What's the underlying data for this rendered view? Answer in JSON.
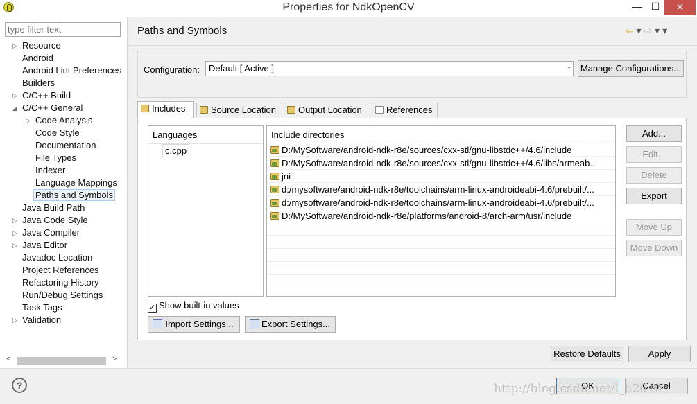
{
  "window": {
    "title": "Properties for NdkOpenCV",
    "controls": {
      "minimize": "—",
      "maximize": "☐",
      "close": "✕"
    }
  },
  "left": {
    "filter_placeholder": "type filter text",
    "tree": [
      {
        "label": "Resource",
        "expandable": true,
        "expanded": false,
        "level": 0
      },
      {
        "label": "Android",
        "expandable": false,
        "level": 0
      },
      {
        "label": "Android Lint Preferences",
        "expandable": false,
        "level": 0
      },
      {
        "label": "Builders",
        "expandable": false,
        "level": 0
      },
      {
        "label": "C/C++ Build",
        "expandable": true,
        "expanded": false,
        "level": 0
      },
      {
        "label": "C/C++ General",
        "expandable": true,
        "expanded": true,
        "level": 0
      },
      {
        "label": "Code Analysis",
        "expandable": true,
        "expanded": false,
        "level": 1
      },
      {
        "label": "Code Style",
        "expandable": false,
        "level": 1
      },
      {
        "label": "Documentation",
        "expandable": false,
        "level": 1
      },
      {
        "label": "File Types",
        "expandable": false,
        "level": 1
      },
      {
        "label": "Indexer",
        "expandable": false,
        "level": 1
      },
      {
        "label": "Language Mappings",
        "expandable": false,
        "level": 1
      },
      {
        "label": "Paths and Symbols",
        "expandable": false,
        "level": 1,
        "selected": true
      },
      {
        "label": "Java Build Path",
        "expandable": false,
        "level": 0
      },
      {
        "label": "Java Code Style",
        "expandable": true,
        "expanded": false,
        "level": 0
      },
      {
        "label": "Java Compiler",
        "expandable": true,
        "expanded": false,
        "level": 0
      },
      {
        "label": "Java Editor",
        "expandable": true,
        "expanded": false,
        "level": 0
      },
      {
        "label": "Javadoc Location",
        "expandable": false,
        "level": 0
      },
      {
        "label": "Project References",
        "expandable": false,
        "level": 0
      },
      {
        "label": "Refactoring History",
        "expandable": false,
        "level": 0
      },
      {
        "label": "Run/Debug Settings",
        "expandable": false,
        "level": 0
      },
      {
        "label": "Task Tags",
        "expandable": false,
        "level": 0
      },
      {
        "label": "Validation",
        "expandable": true,
        "expanded": false,
        "level": 0
      }
    ]
  },
  "main": {
    "title": "Paths and Symbols",
    "nav": {
      "back": "⇦",
      "forward": "⇨",
      "dropdown": "▾",
      "menu": "▾"
    },
    "configuration": {
      "label": "Configuration:",
      "value": "Default  [ Active ]",
      "manage_label": "Manage Configurations..."
    },
    "tabs": [
      {
        "label": "Includes",
        "active": true
      },
      {
        "label": "Source Location",
        "active": false
      },
      {
        "label": "Output Location",
        "active": false
      },
      {
        "label": "References",
        "active": false
      }
    ],
    "languages": {
      "header": "Languages",
      "items": [
        "c,cpp"
      ]
    },
    "include_dirs": {
      "header": "Include directories",
      "items": [
        "D:/MySoftware/android-ndk-r8e/sources/cxx-stl/gnu-libstdc++/4.6/include",
        "D:/MySoftware/android-ndk-r8e/sources/cxx-stl/gnu-libstdc++/4.6/libs/armeab...",
        "jni",
        "d:/mysoftware/android-ndk-r8e/toolchains/arm-linux-androideabi-4.6/prebuilt/...",
        "d:/mysoftware/android-ndk-r8e/toolchains/arm-linux-androideabi-4.6/prebuilt/...",
        "D:/MySoftware/android-ndk-r8e/platforms/android-8/arch-arm/usr/include"
      ]
    },
    "side_buttons": {
      "add": "Add...",
      "edit": "Edit...",
      "delete": "Delete",
      "export": "Export",
      "move_up": "Move Up",
      "move_down": "Move Down"
    },
    "show_builtin": {
      "label": "Show built-in values",
      "checked": true
    },
    "import_settings": "Import Settings...",
    "export_settings": "Export Settings...",
    "restore_defaults": "Restore Defaults",
    "apply": "Apply"
  },
  "footer": {
    "help": "?",
    "ok": "OK",
    "cancel": "Cancel",
    "watermark": "http://blog.csdn.net/l_h2010"
  }
}
